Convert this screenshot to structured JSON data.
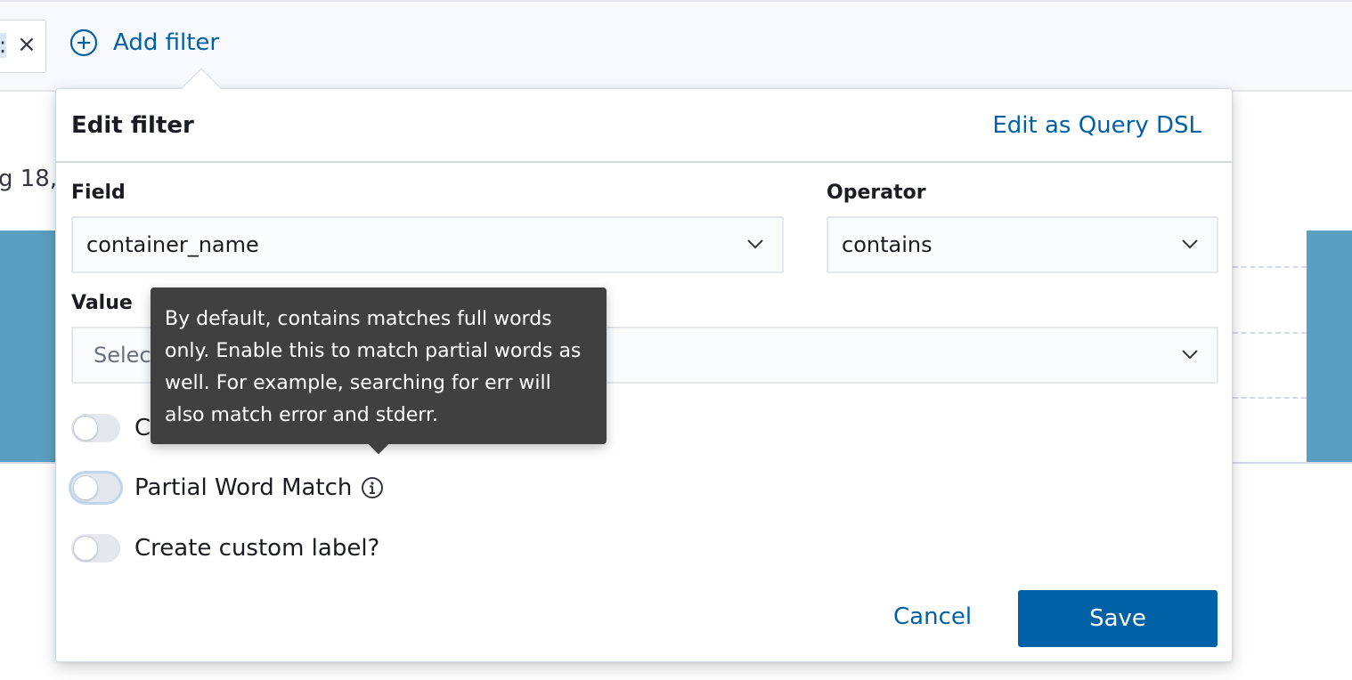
{
  "filter_bar": {
    "pill_fragment": ":",
    "pill_close_icon": "close-icon",
    "add_filter_label": "Add filter",
    "add_filter_icon": "plus-circle-icon"
  },
  "background": {
    "date_fragment": "g 18,"
  },
  "popover": {
    "title": "Edit filter",
    "edit_dsl_link": "Edit as Query DSL",
    "field": {
      "label": "Field",
      "value": "container_name"
    },
    "operator": {
      "label": "Operator",
      "value": "contains"
    },
    "value": {
      "label": "Value",
      "placeholder": "Select"
    },
    "switches": [
      {
        "label": "Case Sensitive",
        "visible_label": "C",
        "checked": false
      },
      {
        "label": "Partial Word Match",
        "checked": false,
        "focused": true,
        "has_info_icon": true
      },
      {
        "label": "Create custom label?",
        "checked": false
      }
    ],
    "cancel_label": "Cancel",
    "save_label": "Save"
  },
  "tooltip": {
    "text": "By default, contains matches full words only. Enable this to match partial words as well. For example, searching for err will also match error and stderr."
  },
  "colors": {
    "link": "#0061a6",
    "primary_button": "#0061a6",
    "tooltip_bg": "#404040",
    "chart_bar": "#5a9fc1"
  }
}
